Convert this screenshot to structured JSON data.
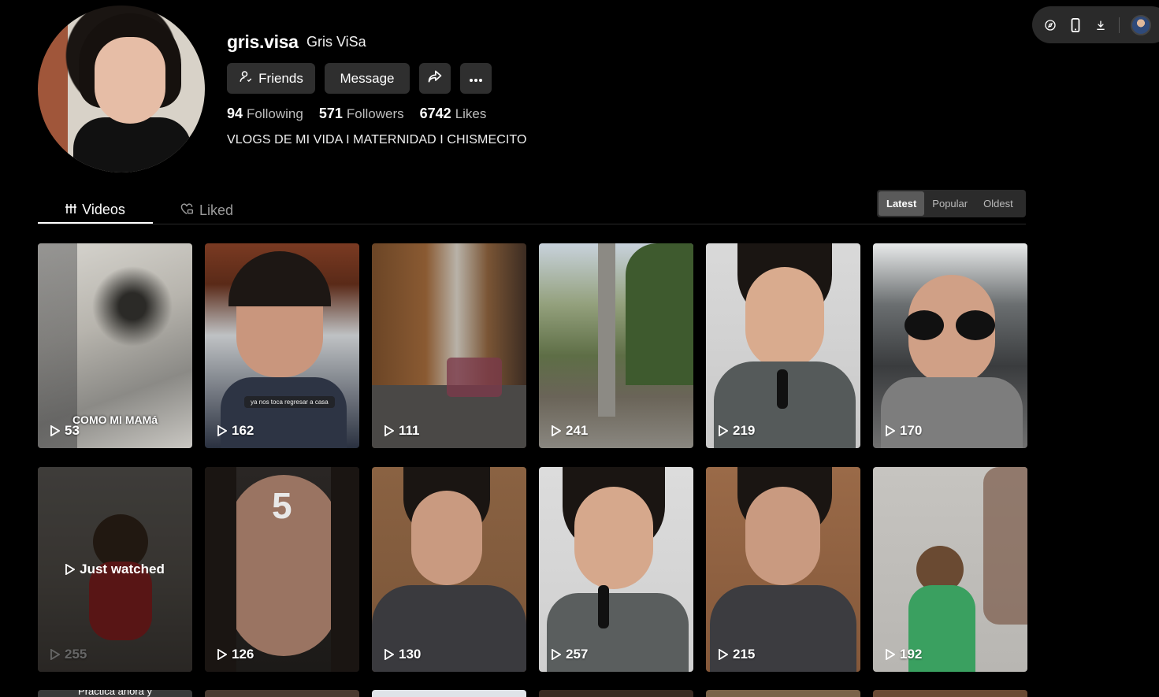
{
  "profile": {
    "username": "gris.visa",
    "nickname": "Gris ViSa",
    "bio": "VLOGS DE MI VIDA I MATERNIDAD I CHISMECITO",
    "buttons": {
      "friends": "Friends",
      "message": "Message"
    },
    "stats": [
      {
        "value": "94",
        "label": "Following"
      },
      {
        "value": "571",
        "label": "Followers"
      },
      {
        "value": "6742",
        "label": "Likes"
      }
    ]
  },
  "toolbar": {
    "icons": [
      "compass-icon",
      "phone-icon",
      "download-icon",
      "user-avatar"
    ]
  },
  "tabs": [
    {
      "label": "Videos",
      "active": true
    },
    {
      "label": "Liked",
      "active": false
    }
  ],
  "sort": {
    "options": [
      "Latest",
      "Popular",
      "Oldest"
    ],
    "selected": "Latest"
  },
  "videos": [
    {
      "views": "53",
      "caption": "COMO MI MAMá"
    },
    {
      "views": "162",
      "subcaption": "ya nos toca regresar a casa"
    },
    {
      "views": "111"
    },
    {
      "views": "241"
    },
    {
      "views": "219"
    },
    {
      "views": "170"
    },
    {
      "views": "255",
      "status": "Just watched"
    },
    {
      "views": "126",
      "overlay": "5"
    },
    {
      "views": "130"
    },
    {
      "views": "257"
    },
    {
      "views": "215"
    },
    {
      "views": "192"
    }
  ],
  "peek_row": {
    "first_caption": "Practica ahora y"
  },
  "colors": {
    "background": "#000000",
    "button": "#2f2f2f",
    "muted": "#9a9a9a"
  }
}
